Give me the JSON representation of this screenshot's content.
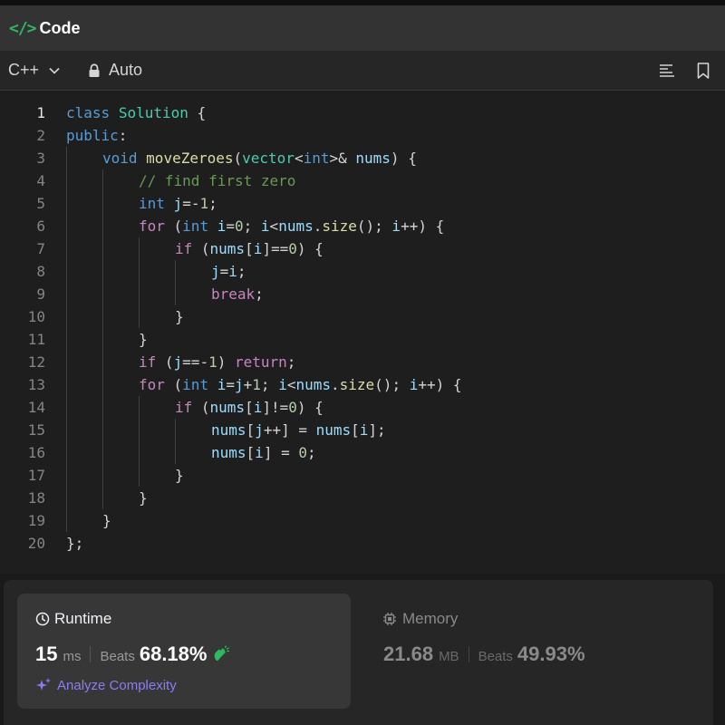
{
  "header": {
    "title": "Code",
    "icon": "code-icon",
    "accent": "#2cbb5d"
  },
  "toolbar": {
    "language": "C++",
    "mode": "Auto",
    "icons": [
      "chevron-down-icon",
      "lock-icon",
      "format-icon",
      "bookmark-icon"
    ]
  },
  "editor": {
    "active_line": 1,
    "lines": [
      {
        "n": "1",
        "indent": 0,
        "tokens": [
          [
            "kw",
            "class"
          ],
          [
            "op",
            " "
          ],
          [
            "ty",
            "Solution"
          ],
          [
            "op",
            " {"
          ]
        ]
      },
      {
        "n": "2",
        "indent": 0,
        "tokens": [
          [
            "kw",
            "public"
          ],
          [
            "op",
            ":"
          ]
        ]
      },
      {
        "n": "3",
        "indent": 1,
        "tokens": [
          [
            "kw",
            "void"
          ],
          [
            "op",
            " "
          ],
          [
            "fn",
            "moveZeroes"
          ],
          [
            "op",
            "("
          ],
          [
            "ty",
            "vector"
          ],
          [
            "op",
            "<"
          ],
          [
            "kw",
            "int"
          ],
          [
            "op",
            ">& "
          ],
          [
            "var",
            "nums"
          ],
          [
            "op",
            ") {"
          ]
        ]
      },
      {
        "n": "4",
        "indent": 2,
        "tokens": [
          [
            "cm",
            "// find first zero"
          ]
        ]
      },
      {
        "n": "5",
        "indent": 2,
        "tokens": [
          [
            "kw",
            "int"
          ],
          [
            "op",
            " "
          ],
          [
            "var",
            "j"
          ],
          [
            "op",
            "=-"
          ],
          [
            "num",
            "1"
          ],
          [
            "op",
            ";"
          ]
        ]
      },
      {
        "n": "6",
        "indent": 2,
        "tokens": [
          [
            "ctl",
            "for"
          ],
          [
            "op",
            " ("
          ],
          [
            "kw",
            "int"
          ],
          [
            "op",
            " "
          ],
          [
            "var",
            "i"
          ],
          [
            "op",
            "="
          ],
          [
            "num",
            "0"
          ],
          [
            "op",
            "; "
          ],
          [
            "var",
            "i"
          ],
          [
            "op",
            "<"
          ],
          [
            "var",
            "nums"
          ],
          [
            "op",
            "."
          ],
          [
            "fn",
            "size"
          ],
          [
            "op",
            "(); "
          ],
          [
            "var",
            "i"
          ],
          [
            "op",
            "++) {"
          ]
        ]
      },
      {
        "n": "7",
        "indent": 3,
        "tokens": [
          [
            "ctl",
            "if"
          ],
          [
            "op",
            " ("
          ],
          [
            "var",
            "nums"
          ],
          [
            "op",
            "["
          ],
          [
            "var",
            "i"
          ],
          [
            "op",
            "]=="
          ],
          [
            "num",
            "0"
          ],
          [
            "op",
            ") {"
          ]
        ]
      },
      {
        "n": "8",
        "indent": 4,
        "tokens": [
          [
            "var",
            "j"
          ],
          [
            "op",
            "="
          ],
          [
            "var",
            "i"
          ],
          [
            "op",
            ";"
          ]
        ]
      },
      {
        "n": "9",
        "indent": 4,
        "tokens": [
          [
            "ctl",
            "break"
          ],
          [
            "op",
            ";"
          ]
        ]
      },
      {
        "n": "10",
        "indent": 3,
        "tokens": [
          [
            "op",
            "}"
          ]
        ]
      },
      {
        "n": "11",
        "indent": 2,
        "tokens": [
          [
            "op",
            "}"
          ]
        ]
      },
      {
        "n": "12",
        "indent": 2,
        "tokens": [
          [
            "ctl",
            "if"
          ],
          [
            "op",
            " ("
          ],
          [
            "var",
            "j"
          ],
          [
            "op",
            "==-"
          ],
          [
            "num",
            "1"
          ],
          [
            "op",
            ") "
          ],
          [
            "ctl",
            "return"
          ],
          [
            "op",
            ";"
          ]
        ]
      },
      {
        "n": "13",
        "indent": 2,
        "tokens": [
          [
            "ctl",
            "for"
          ],
          [
            "op",
            " ("
          ],
          [
            "kw",
            "int"
          ],
          [
            "op",
            " "
          ],
          [
            "var",
            "i"
          ],
          [
            "op",
            "="
          ],
          [
            "var",
            "j"
          ],
          [
            "op",
            "+"
          ],
          [
            "num",
            "1"
          ],
          [
            "op",
            "; "
          ],
          [
            "var",
            "i"
          ],
          [
            "op",
            "<"
          ],
          [
            "var",
            "nums"
          ],
          [
            "op",
            "."
          ],
          [
            "fn",
            "size"
          ],
          [
            "op",
            "(); "
          ],
          [
            "var",
            "i"
          ],
          [
            "op",
            "++) {"
          ]
        ]
      },
      {
        "n": "14",
        "indent": 3,
        "tokens": [
          [
            "ctl",
            "if"
          ],
          [
            "op",
            " ("
          ],
          [
            "var",
            "nums"
          ],
          [
            "op",
            "["
          ],
          [
            "var",
            "i"
          ],
          [
            "op",
            "]!="
          ],
          [
            "num",
            "0"
          ],
          [
            "op",
            ") {"
          ]
        ]
      },
      {
        "n": "15",
        "indent": 4,
        "tokens": [
          [
            "var",
            "nums"
          ],
          [
            "op",
            "["
          ],
          [
            "var",
            "j"
          ],
          [
            "op",
            "++] = "
          ],
          [
            "var",
            "nums"
          ],
          [
            "op",
            "["
          ],
          [
            "var",
            "i"
          ],
          [
            "op",
            "];"
          ]
        ]
      },
      {
        "n": "16",
        "indent": 4,
        "tokens": [
          [
            "var",
            "nums"
          ],
          [
            "op",
            "["
          ],
          [
            "var",
            "i"
          ],
          [
            "op",
            "] = "
          ],
          [
            "num",
            "0"
          ],
          [
            "op",
            ";"
          ]
        ]
      },
      {
        "n": "17",
        "indent": 3,
        "tokens": [
          [
            "op",
            "}"
          ]
        ]
      },
      {
        "n": "18",
        "indent": 2,
        "tokens": [
          [
            "op",
            "}"
          ]
        ]
      },
      {
        "n": "19",
        "indent": 1,
        "tokens": [
          [
            "op",
            "}"
          ]
        ]
      },
      {
        "n": "20",
        "indent": 0,
        "tokens": [
          [
            "op",
            "};"
          ]
        ]
      }
    ]
  },
  "runtime": {
    "title": "Runtime",
    "value": "15",
    "unit": "ms",
    "beats_label": "Beats",
    "beats_pct": "68.18%",
    "analyze_label": "Analyze Complexity",
    "accent": "#8b7cf6"
  },
  "memory": {
    "title": "Memory",
    "value": "21.68",
    "unit": "MB",
    "beats_label": "Beats",
    "beats_pct": "49.93%"
  }
}
